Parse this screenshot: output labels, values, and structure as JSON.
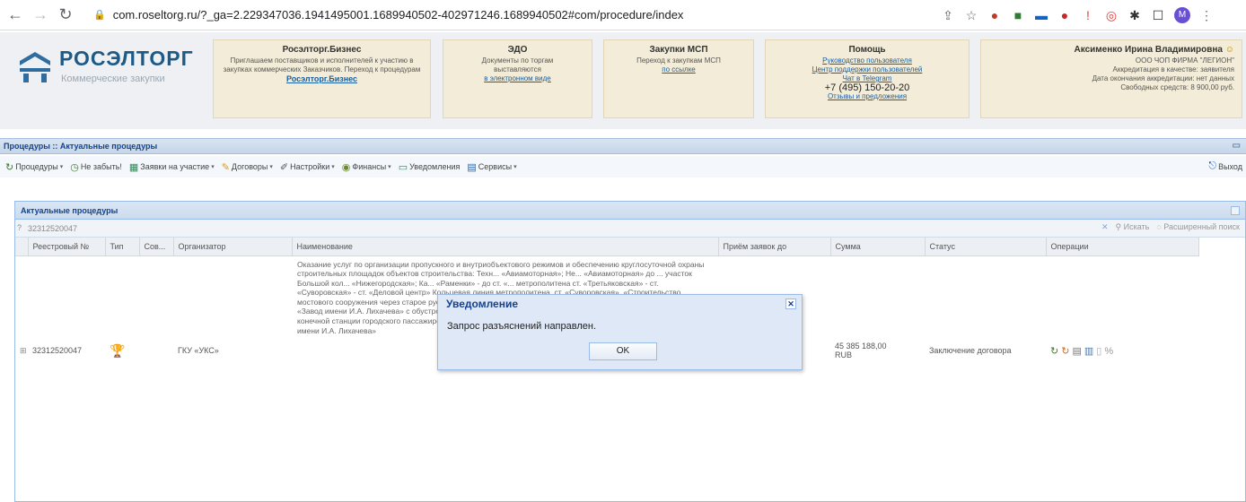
{
  "browser": {
    "url": "com.roseltorg.ru/?_ga=2.229347036.1941495001.1689940502-402971246.1689940502#com/procedure/index",
    "avatar_letter": "M"
  },
  "header": {
    "logo_title": "РОСЭЛТОРГ",
    "logo_subtitle": "Коммерческие закупки",
    "business": {
      "title": "Росэлторг.Бизнес",
      "text": "Приглашаем поставщиков и исполнителей к участию в закупках коммерческих Заказчиков. Переход к процедурам",
      "link": "Росэлторг.Бизнес"
    },
    "edo": {
      "title": "ЭДО",
      "text": "Документы по торгам выставляются",
      "link": "в электронном виде"
    },
    "msp": {
      "title": "Закупки МСП",
      "text": "Переход к закупкам МСП",
      "link": "по ссылке"
    },
    "help": {
      "title": "Помощь",
      "link1": "Руководство пользователя",
      "link2": "Центр поддержки пользователей",
      "link3": "Чат в Telegram",
      "phone": "+7 (495) 150-20-20",
      "link4": "Отзывы и предложения"
    },
    "user": {
      "name": "Аксименко Ирина Владимировна",
      "org": "ООО ЧОП ФИРМА \"ЛЕГИОН\"",
      "line1": "Аккредитация в качестве: заявителя",
      "line2": "Дата окончания аккредитации: нет данных",
      "line3": "Свободных средств: 8 900,00 руб."
    }
  },
  "titlebar": {
    "label": "Процедуры :: Актуальные процедуры"
  },
  "toolbar": {
    "items": [
      "Процедуры",
      "Не забыть!",
      "Заявки на участие",
      "Договоры",
      "Настройки",
      "Финансы",
      "Уведомления",
      "Сервисы"
    ],
    "exit": "Выход"
  },
  "panel": {
    "title": "Актуальные процедуры",
    "search_value": "32312520047",
    "search_btn": "Искать",
    "advanced_btn": "Расширенный поиск"
  },
  "table": {
    "headers": [
      "Реестровый №",
      "Тип",
      "Сов...",
      "Организатор",
      "Наименование",
      "Приём заявок до",
      "Сумма",
      "Статус",
      "Операции"
    ],
    "row": {
      "number": "32312520047",
      "organizer": "ГКУ «УКС»",
      "name": "Оказание услуг по организации пропускного и внутриобъектового режимов и обеспечению круглосуточной охраны строительных площадок объектов строительства: Техн... «Авиамоторная»; Не... «Авиамоторная» до ... участок Большой кол... «Нижегородская»; Ка... «Раменки» - до ст. «... метрополитена ст. «Третьяковская» - ст. «Суворовская» - ст. «Деловой центр» Кольцевая линия метрополитена, ст. «Суворовская», «Строительство мостового сооружения через старое русло Москва-реки с улично-дорожной сетью в южной части территории ПАО «Завод имени И.А. Лихачева» с обустройством пешеходных переходов, отстойно-разворотной площадки, здания конечной станции городского пассажирского транспорта. Обустройство набережной р. Москва в районе ПАО «Завод имени И.А. Лихачева»",
      "amount": "45 385 188,00",
      "currency": "RUB",
      "status": "Заключение договора"
    }
  },
  "dialog": {
    "title": "Уведомление",
    "message": "Запрос разъяснений направлен.",
    "ok": "OK"
  }
}
